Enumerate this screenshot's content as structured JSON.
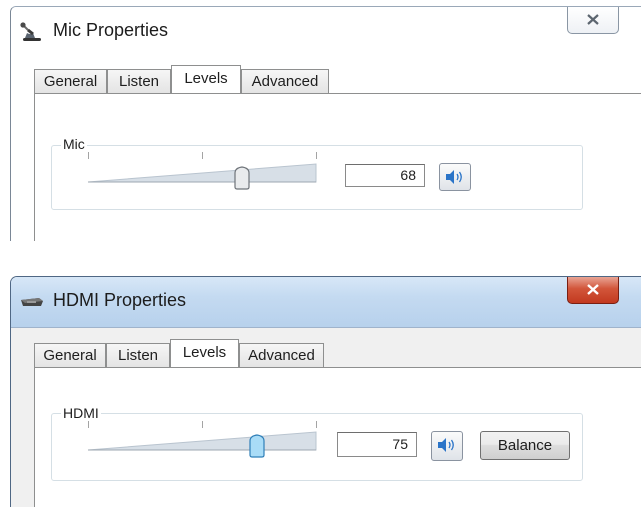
{
  "mic_dialog": {
    "title": "Mic Properties",
    "icon": "microphone-icon",
    "tabs": [
      "General",
      "Listen",
      "Levels",
      "Advanced"
    ],
    "active_tab": "Levels",
    "group_label": "Mic",
    "level": 68,
    "level_text": "68",
    "buttons": {
      "mute_icon": "speaker-icon"
    }
  },
  "hdmi_dialog": {
    "title": "HDMI Properties",
    "icon": "hdmi-device-icon",
    "tabs": [
      "General",
      "Listen",
      "Levels",
      "Advanced"
    ],
    "active_tab": "Levels",
    "group_label": "HDMI",
    "level": 75,
    "level_text": "75",
    "buttons": {
      "mute_icon": "speaker-icon",
      "balance_label": "Balance"
    }
  },
  "colors": {
    "close_red": "#c2391f",
    "titlebar_blue": "#c4daf1",
    "thumb_blue": "#7ec3ef"
  }
}
